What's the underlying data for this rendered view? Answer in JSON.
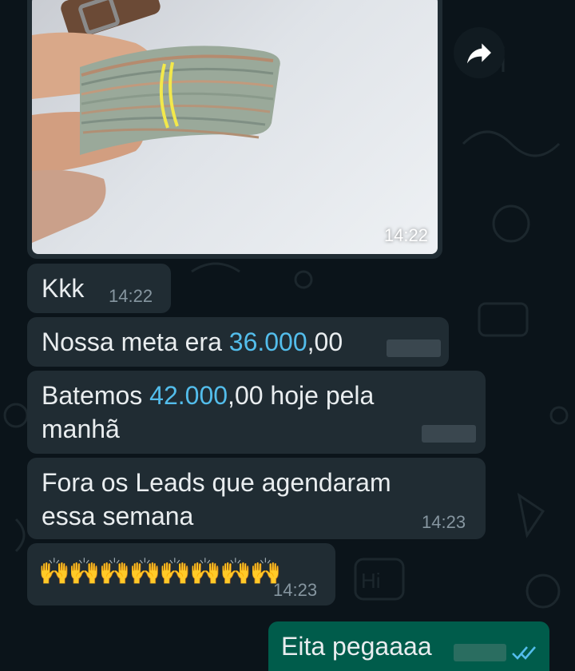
{
  "colors": {
    "background": "#0b141a",
    "incoming_bubble": "#202c33",
    "outgoing_bubble": "#005c4b",
    "number_link": "#53bdeb",
    "text": "#e9edef",
    "timestamp": "#8696a0",
    "read_check": "#53bdeb"
  },
  "image_message": {
    "time": "14:22",
    "alt": "photo of a stack of banknotes tied with a rubber band"
  },
  "forward_button": {
    "icon": "forward-arrow-icon"
  },
  "messages": [
    {
      "text": "Kkk",
      "time": "14:22"
    },
    {
      "prefix": "Nossa meta era ",
      "number": "36.000",
      "suffix": ",00",
      "time_redacted": true
    },
    {
      "prefix": "Batemos ",
      "number": "42.000",
      "suffix": ",00 hoje pela",
      "line2": "manhã",
      "time_redacted": true
    },
    {
      "line1": "Fora os Leads que agendaram",
      "line2": "essa semana",
      "time": "14:23"
    },
    {
      "emoji": "🙌🙌🙌🙌🙌🙌🙌🙌",
      "time": "14:23"
    }
  ],
  "outgoing": {
    "text": "Eita pegaaaa",
    "status_icon": "double-check-icon",
    "time_redacted": true
  }
}
